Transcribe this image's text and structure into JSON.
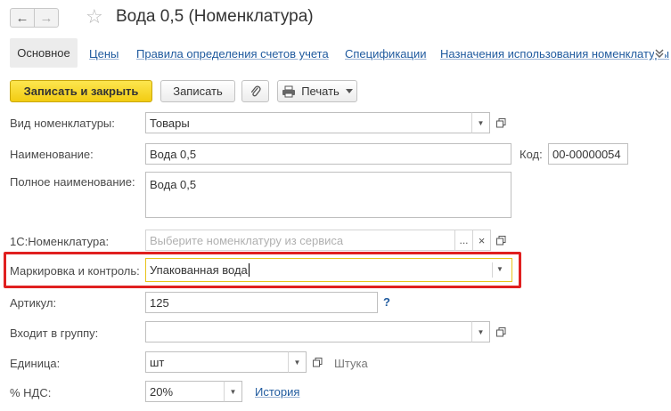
{
  "window": {
    "title": "Вода 0,5 (Номенклатура)",
    "back_glyph": "←",
    "forward_glyph": "→",
    "star_glyph": "☆"
  },
  "tabs": {
    "active": "Основное",
    "links": [
      "Цены",
      "Правила определения счетов учета",
      "Спецификации",
      "Назначения использования номенклатуры"
    ]
  },
  "toolbar": {
    "save_close": "Записать и закрыть",
    "save": "Записать",
    "print": "Печать"
  },
  "form": {
    "kind": {
      "label": "Вид номенклатуры:",
      "value": "Товары"
    },
    "name": {
      "label": "Наименование:",
      "value": "Вода 0,5"
    },
    "code": {
      "label": "Код:",
      "value": "00-00000054"
    },
    "full_name": {
      "label": "Полное наименование:",
      "value": "Вода 0,5"
    },
    "onec": {
      "label": "1С:Номенклатура:",
      "placeholder": "Выберите номенклатуру из сервиса",
      "dots": "..."
    },
    "marking": {
      "label": "Маркировка и контроль:",
      "value": "Упакованная вода"
    },
    "article": {
      "label": "Артикул:",
      "value": "125",
      "help": "?"
    },
    "group": {
      "label": "Входит в группу:",
      "value": ""
    },
    "unit": {
      "label": "Единица:",
      "value": "шт",
      "hint": "Штука"
    },
    "vat": {
      "label": "% НДС:",
      "value": "20%",
      "history": "История"
    }
  },
  "colors": {
    "accent_yellow": "#f5d01c",
    "highlight_red": "#e02020",
    "link_blue": "#1f5a9e"
  }
}
